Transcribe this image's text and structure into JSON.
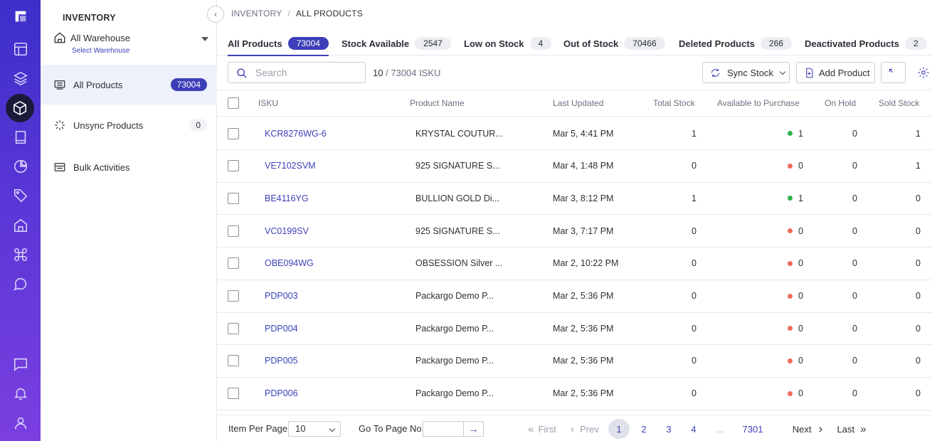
{
  "sidebar": {
    "title": "INVENTORY",
    "warehouse": {
      "name": "All Warehouse",
      "sub": "Select Warehouse"
    },
    "items": [
      {
        "label": "All Products",
        "badge": "73004"
      },
      {
        "label": "Unsync Products",
        "badge": "0"
      },
      {
        "label": "Bulk Activities"
      }
    ]
  },
  "breadcrumb": {
    "root": "INVENTORY",
    "sep": "/",
    "current": "ALL PRODUCTS"
  },
  "tabs": [
    {
      "label": "All Products",
      "count": "73004"
    },
    {
      "label": "Stock Available",
      "count": "2547"
    },
    {
      "label": "Low on Stock",
      "count": "4"
    },
    {
      "label": "Out of Stock",
      "count": "70466"
    },
    {
      "label": "Deleted Products",
      "count": "266"
    },
    {
      "label": "Deactivated Products",
      "count": "2"
    }
  ],
  "toolbar": {
    "search_placeholder": "Search",
    "count_shown": "10",
    "count_total": " / 73004 ISKU",
    "sync_label": "Sync Stock",
    "add_label": "Add Product"
  },
  "table": {
    "headers": [
      "ISKU",
      "Product Name",
      "Last Updated",
      "Total Stock",
      "Available to Purchase",
      "On Hold",
      "Sold Stock"
    ],
    "rows": [
      {
        "isku": "KCR8276WG-6",
        "name": "KRYSTAL COUTUR...",
        "updated": "Mar 5, 4:41 PM",
        "total": "1",
        "available": "1",
        "status": "green",
        "hold": "0",
        "sold": "1"
      },
      {
        "isku": "VE7102SVM",
        "name": "925 SIGNATURE S...",
        "updated": "Mar 4, 1:48 PM",
        "total": "0",
        "available": "0",
        "status": "red",
        "hold": "0",
        "sold": "1"
      },
      {
        "isku": "BE4116YG",
        "name": "BULLION GOLD Di...",
        "updated": "Mar 3, 8:12 PM",
        "total": "1",
        "available": "1",
        "status": "green",
        "hold": "0",
        "sold": "0"
      },
      {
        "isku": "VC0199SV",
        "name": "925 SIGNATURE S...",
        "updated": "Mar 3, 7:17 PM",
        "total": "0",
        "available": "0",
        "status": "red",
        "hold": "0",
        "sold": "0"
      },
      {
        "isku": "OBE094WG",
        "name": "OBSESSION Silver ...",
        "updated": "Mar 2, 10:22 PM",
        "total": "0",
        "available": "0",
        "status": "red",
        "hold": "0",
        "sold": "0"
      },
      {
        "isku": "PDP003",
        "name": "Packargo Demo P...",
        "updated": "Mar 2, 5:36 PM",
        "total": "0",
        "available": "0",
        "status": "red",
        "hold": "0",
        "sold": "0"
      },
      {
        "isku": "PDP004",
        "name": "Packargo Demo P...",
        "updated": "Mar 2, 5:36 PM",
        "total": "0",
        "available": "0",
        "status": "red",
        "hold": "0",
        "sold": "0"
      },
      {
        "isku": "PDP005",
        "name": "Packargo Demo P...",
        "updated": "Mar 2, 5:36 PM",
        "total": "0",
        "available": "0",
        "status": "red",
        "hold": "0",
        "sold": "0"
      },
      {
        "isku": "PDP006",
        "name": "Packargo Demo P...",
        "updated": "Mar 2, 5:36 PM",
        "total": "0",
        "available": "0",
        "status": "red",
        "hold": "0",
        "sold": "0"
      }
    ]
  },
  "footer": {
    "per_page_label": "Item Per Page",
    "per_page_value": "10",
    "goto_label": "Go To Page No.",
    "first": "First",
    "prev": "Prev",
    "pages": [
      "1",
      "2",
      "3",
      "4"
    ],
    "ellipsis": "...",
    "last_page": "7301",
    "next": "Next",
    "last": "Last"
  },
  "colors": {
    "accent": "#3d3fb8",
    "green": "#2fb24a",
    "red": "#ef6b5b",
    "rail_top": "#3b2fc9",
    "rail_bottom": "#7b3fe0"
  }
}
